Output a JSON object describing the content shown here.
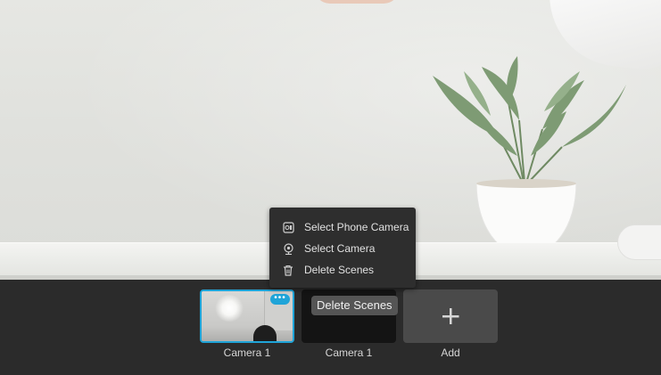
{
  "context_menu": {
    "items": [
      {
        "label": "Select Phone Camera",
        "icon": "phone-camera-icon"
      },
      {
        "label": "Select Camera",
        "icon": "webcam-icon"
      },
      {
        "label": "Delete Scenes",
        "icon": "trash-icon"
      }
    ]
  },
  "scenes": [
    {
      "label": "Camera 1",
      "selected": true,
      "more_glyph": "•••"
    },
    {
      "label": "Camera 1",
      "selected": false
    }
  ],
  "add_scene": {
    "label": "Add",
    "icon": "plus-icon"
  },
  "tooltip": {
    "text": "Delete Scenes"
  },
  "colors": {
    "accent": "#1fa4d8",
    "bar_background": "#2b2b2b",
    "menu_background": "#2e2e2e"
  }
}
